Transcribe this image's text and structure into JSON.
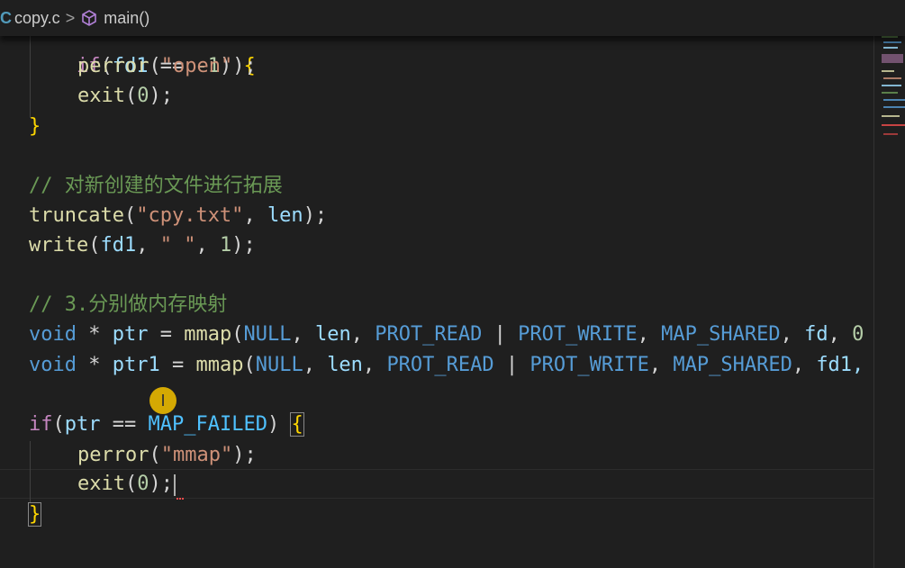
{
  "breadcrumb": {
    "lang_glyph": "C",
    "file": "copy.c",
    "separator": ">",
    "symbol_icon": "cube-icon",
    "symbol": "main()"
  },
  "code": {
    "l0": "if(fd1 == -1) {",
    "l1_fn": "perror",
    "l1_str": "\"open\"",
    "l2_fn": "exit",
    "l2_num": "0",
    "l3": "}",
    "l5": "// 对新创建的文件进行拓展",
    "l6_fn": "truncate",
    "l6_str": "\"cpy.txt\"",
    "l6_var": "len",
    "l7_fn": "write",
    "l7_var": "fd1",
    "l7_str": "\" \"",
    "l7_num": "1",
    "l9": "// 3.分别做内存映射",
    "l10": {
      "type": "void",
      "star": " * ",
      "var": "ptr",
      "eq": " = ",
      "fn": "mmap",
      "a1": "NULL",
      "a2": "len",
      "a3": "PROT_READ",
      "a4": "PROT_WRITE",
      "a5": "MAP_SHARED",
      "a6": "fd",
      "a7": "0"
    },
    "l11": {
      "type": "void",
      "star": " * ",
      "var": "ptr1",
      "eq": " = ",
      "fn": "mmap",
      "a1": "NULL",
      "a2": "len",
      "a3": "PROT_READ",
      "a4": "PROT_WRITE",
      "a5": "MAP_SHARED",
      "a6": "fd1,"
    },
    "l13": {
      "kw": "if",
      "var": "ptr",
      "op": " == ",
      "const": "MAP_FAILED"
    },
    "l14_fn": "perror",
    "l14_str": "\"mmap\"",
    "l15_fn": "exit",
    "l15_num": "0",
    "l16": "}"
  },
  "cursor_glyph": "I",
  "colors": {
    "background": "#1f1f1f",
    "function": "#dcdcaa",
    "string": "#ce9178",
    "keyword": "#569cd6",
    "comment": "#6a9955",
    "variable": "#9cdcfe",
    "constant": "#4fc1ff"
  }
}
